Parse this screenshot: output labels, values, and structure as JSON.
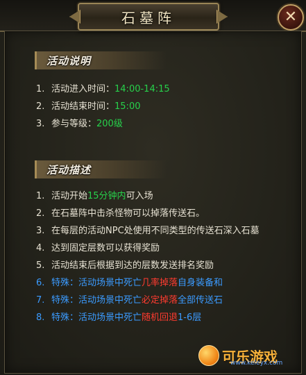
{
  "window": {
    "title": "石墓阵",
    "close_glyph": "✕",
    "close_icon": "close-icon"
  },
  "section_rules": {
    "title": "活动说明",
    "lines": [
      {
        "num": "1.",
        "label": "活动进入时间：",
        "value": "14:00-14:15"
      },
      {
        "num": "2.",
        "label": "活动结束时间：",
        "value": "15:00"
      },
      {
        "num": "3.",
        "label": "参与等级：",
        "value": "200级"
      }
    ]
  },
  "section_desc": {
    "title": "活动描述",
    "lines": [
      {
        "num": "1.",
        "a": "活动开始",
        "b": "15分钟内",
        "c": "可入场"
      },
      {
        "num": "2.",
        "text": "在石墓阵中击杀怪物可以掉落传送石。"
      },
      {
        "num": "3.",
        "text": "在每层的活动NPC处使用不同类型的传送石深入石墓"
      },
      {
        "num": "4.",
        "text": "达到固定层数可以获得奖励"
      },
      {
        "num": "5.",
        "text": "活动结束后根据到达的层数发送排名奖励"
      },
      {
        "num": "6.",
        "a": "特殊：活动场景中死亡",
        "b": "几率掉落",
        "c": "自身装备和"
      },
      {
        "num": "7.",
        "a": "特殊：活动场景中死亡",
        "b": "必定掉落",
        "c": "全部传送石"
      },
      {
        "num": "8.",
        "a": "特殊：活动场景中死亡",
        "b": "随机回退",
        "c": "1-6层"
      }
    ]
  },
  "watermark": {
    "brand": "可乐游戏",
    "url": "www.keleyx.com"
  },
  "colors": {
    "accent_green": "#27d14b",
    "accent_red": "#ff3b30",
    "accent_blue": "#3b9bff",
    "text": "#e7e2d3"
  }
}
